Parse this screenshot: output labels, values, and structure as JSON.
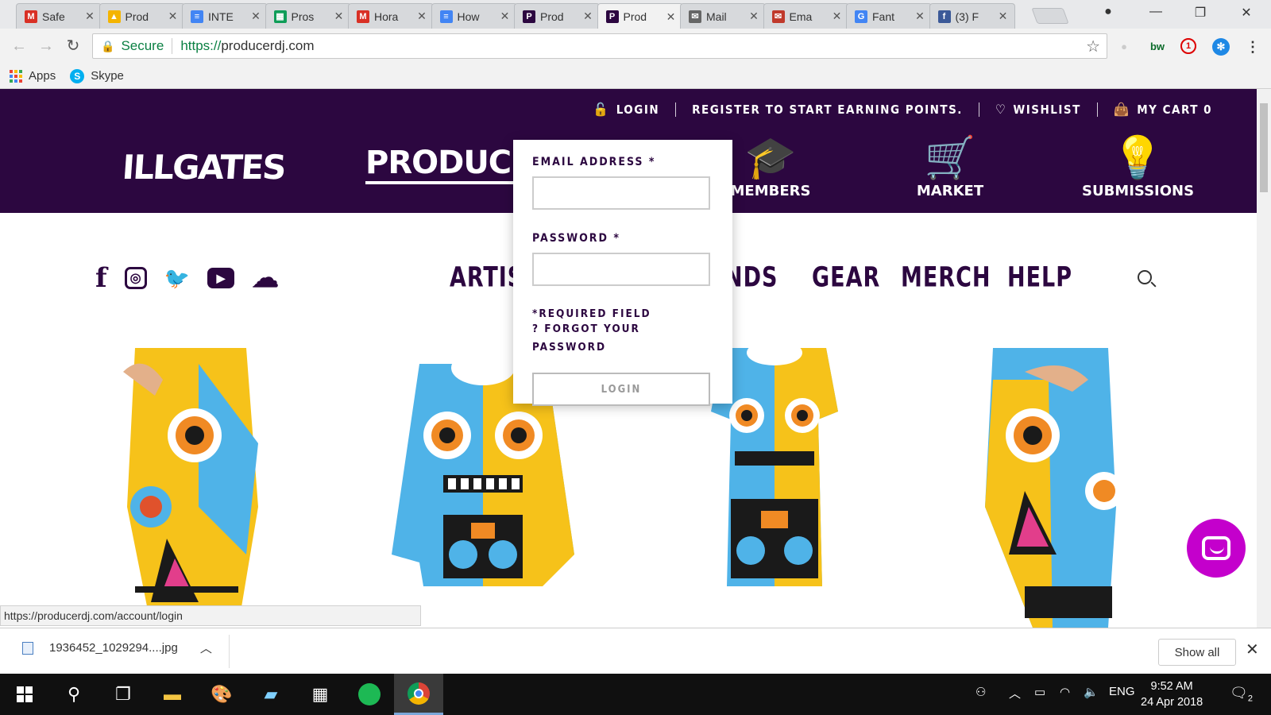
{
  "browser": {
    "tabs": [
      {
        "title": "Safe",
        "icon": "gmail-icon",
        "color": "#d93025",
        "glyph": "M"
      },
      {
        "title": "Prod",
        "icon": "google-drive-icon",
        "color": "#f4b400",
        "glyph": "▲"
      },
      {
        "title": "INTE",
        "icon": "google-docs-icon",
        "color": "#4285f4",
        "glyph": "≡"
      },
      {
        "title": "Pros",
        "icon": "google-sheets-icon",
        "color": "#0f9d58",
        "glyph": "▦"
      },
      {
        "title": "Hora",
        "icon": "gmail-icon",
        "color": "#d93025",
        "glyph": "M"
      },
      {
        "title": "How",
        "icon": "google-docs-icon",
        "color": "#4285f4",
        "glyph": "≡"
      },
      {
        "title": "Prod",
        "icon": "producerdj-icon",
        "color": "#2c0740",
        "glyph": "P"
      },
      {
        "title": "Prod",
        "icon": "producerdj-icon",
        "color": "#2c0740",
        "glyph": "P"
      },
      {
        "title": "Mail",
        "icon": "mail-icon",
        "color": "#666666",
        "glyph": "✉"
      },
      {
        "title": "Ema",
        "icon": "email-icon",
        "color": "#c0392b",
        "glyph": "✉"
      },
      {
        "title": "Fant",
        "icon": "google-icon",
        "color": "#4285f4",
        "glyph": "G"
      },
      {
        "title": "(3) F",
        "icon": "facebook-icon",
        "color": "#3b5998",
        "glyph": "f"
      }
    ],
    "active_tab_index": 7,
    "secure_label": "Secure",
    "url_scheme": "https://",
    "url_host": "producerdj.com",
    "bookmarks": [
      {
        "label": "Apps"
      },
      {
        "label": "Skype"
      }
    ],
    "extensions": [
      "bw"
    ],
    "extension_badge": "1"
  },
  "site": {
    "top_nav": {
      "login": "LOGIN",
      "register": "REGISTER TO START EARNING POINTS.",
      "wishlist": "WISHLIST",
      "cart": "MY CART 0"
    },
    "logos": {
      "illgates": "ILLGATES",
      "producer": "PRODUCE"
    },
    "header_nav": [
      {
        "label": "MEMBERS",
        "icon": "graduate-icon",
        "glyph": "🎓"
      },
      {
        "label": "MARKET",
        "icon": "cart-icon",
        "glyph": "🛒"
      },
      {
        "label": "SUBMISSIONS",
        "icon": "lightbulb-icon",
        "glyph": "💡"
      }
    ],
    "social": [
      {
        "icon": "facebook-icon",
        "glyph": "f"
      },
      {
        "icon": "instagram-icon",
        "glyph": "◎"
      },
      {
        "icon": "twitter-icon",
        "glyph": "🐦"
      },
      {
        "icon": "youtube-icon",
        "glyph": "▶"
      },
      {
        "icon": "soundcloud-icon",
        "glyph": "☁"
      }
    ],
    "main_nav": [
      "ARTIST",
      "NDS",
      "GEAR",
      "MERCH",
      "HELP"
    ],
    "login_popup": {
      "email_label": "EMAIL ADDRESS",
      "password_label": "PASSWORD",
      "required_mark": "*",
      "required_note": "*REQUIRED FIELD",
      "forgot": "? FORGOT YOUR PASSWORD",
      "button": "LOGIN"
    }
  },
  "status_url": "https://producerdj.com/account/login",
  "downloads": {
    "filename": "1936452_1029294....jpg",
    "show_all": "Show all"
  },
  "taskbar": {
    "language": "ENG",
    "time": "9:52 AM",
    "date": "24 Apr 2018",
    "notifications": "2"
  },
  "colors": {
    "brand": "#2c0740",
    "chat": "#c400cc"
  }
}
